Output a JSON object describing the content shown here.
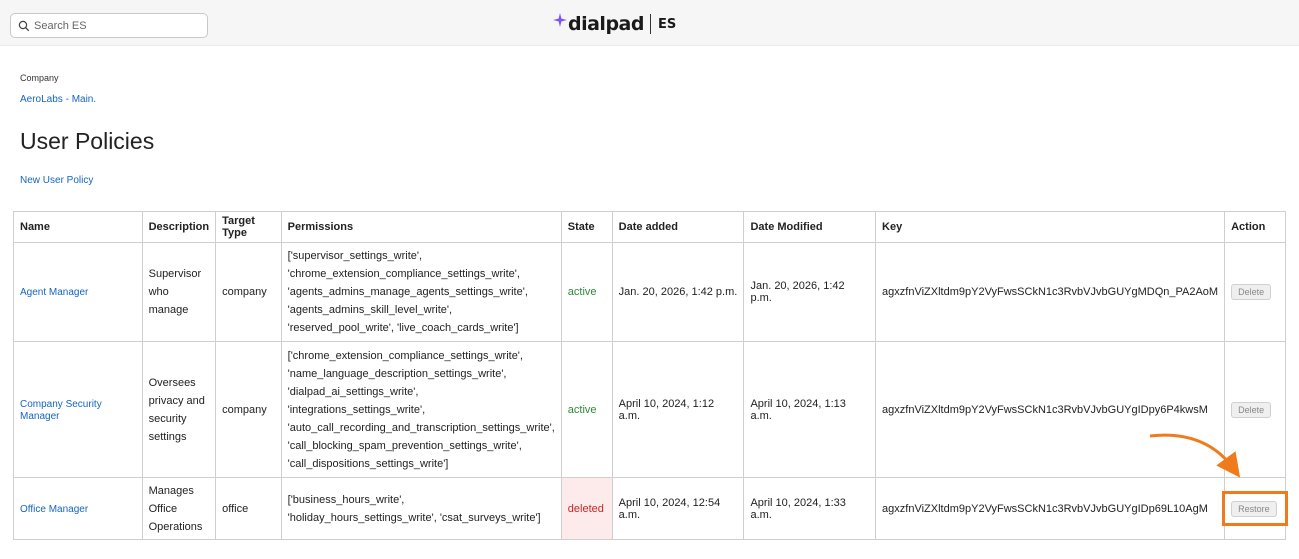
{
  "search": {
    "placeholder": "Search ES"
  },
  "brand": {
    "wordmark": "dialpad",
    "suffix": "ES",
    "accent_color": "#7c52ff"
  },
  "breadcrumb": {
    "label": "Company",
    "link": "AeroLabs - Main."
  },
  "page": {
    "title": "User Policies",
    "new_link": "New User Policy"
  },
  "table": {
    "headers": [
      "Name",
      "Description",
      "Target Type",
      "Permissions",
      "State",
      "Date added",
      "Date Modified",
      "Key",
      "Action"
    ],
    "rows": [
      {
        "name": "Agent Manager",
        "description": [
          "Supervisor",
          "who",
          "manage"
        ],
        "target_type": "company",
        "permissions": [
          "['supervisor_settings_write',",
          "'chrome_extension_compliance_settings_write',",
          "'agents_admins_manage_agents_settings_write',",
          "'agents_admins_skill_level_write',",
          "'reserved_pool_write', 'live_coach_cards_write']"
        ],
        "state": "active",
        "date_added": "Jan. 20, 2026, 1:42 p.m.",
        "date_modified": "Jan. 20, 2026, 1:42 p.m.",
        "key": "agxzfnViZXltdm9pY2VyFwsSCkN1c3RvbVJvbGUYgMDQn_PA2AoM",
        "action": "Delete"
      },
      {
        "name": "Company Security Manager",
        "description": [
          "Oversees",
          "privacy and",
          "security",
          "settings"
        ],
        "target_type": "company",
        "permissions": [
          "['chrome_extension_compliance_settings_write',",
          "'name_language_description_settings_write',",
          "'dialpad_ai_settings_write',",
          "'integrations_settings_write',",
          "'auto_call_recording_and_transcription_settings_write',",
          "'call_blocking_spam_prevention_settings_write',",
          "'call_dispositions_settings_write']"
        ],
        "state": "active",
        "date_added": "April 10, 2024, 1:12 a.m.",
        "date_modified": "April 10, 2024, 1:13 a.m.",
        "key": "agxzfnViZXltdm9pY2VyFwsSCkN1c3RvbVJvbGUYgIDpy6P4kwsM",
        "action": "Delete"
      },
      {
        "name": "Office Manager",
        "description": [
          "Manages",
          "Office",
          "Operations"
        ],
        "target_type": "office",
        "permissions": [
          "['business_hours_write',",
          "'holiday_hours_settings_write', 'csat_surveys_write']"
        ],
        "state": "deleted",
        "date_added": "April 10, 2024, 12:54 a.m.",
        "date_modified": "April 10, 2024, 1:33 a.m.",
        "key": "agxzfnViZXltdm9pY2VyFwsSCkN1c3RvbVJvbGUYgIDp69L10AgM",
        "action": "Restore"
      }
    ]
  },
  "annotation": {
    "color": "#f07b1d"
  }
}
